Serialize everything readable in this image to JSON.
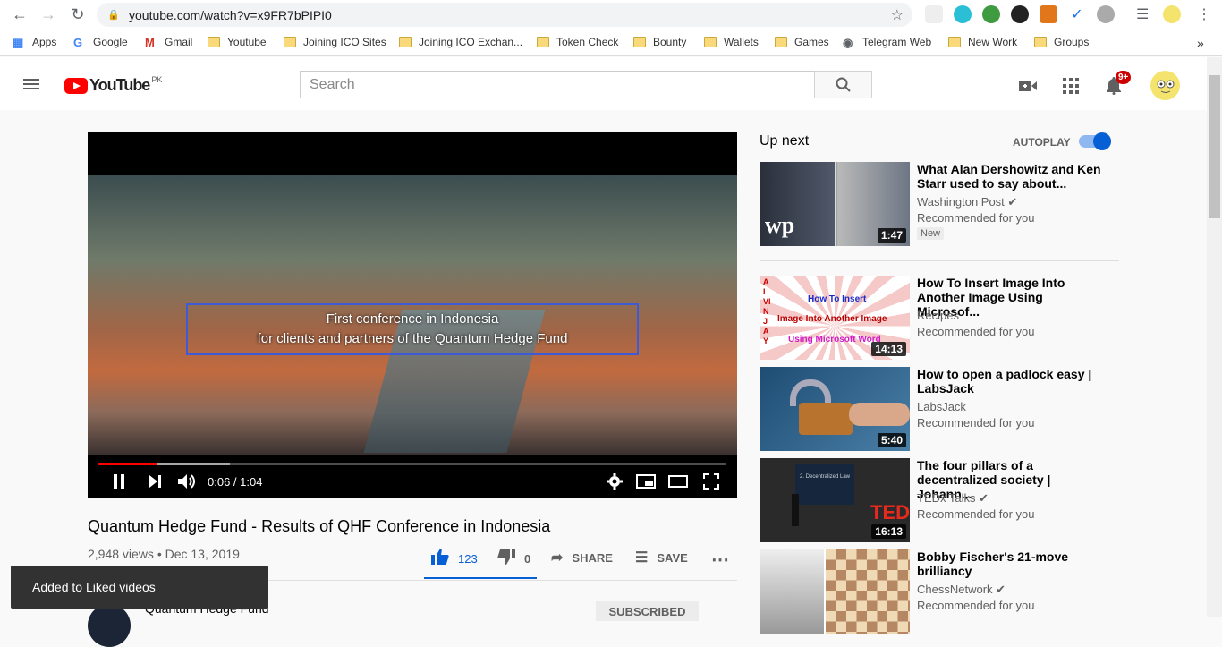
{
  "browser": {
    "url": "youtube.com/watch?v=x9FR7bPIPI0",
    "bookmarks": [
      "Apps",
      "Google",
      "Gmail",
      "Youtube",
      "Joining ICO Sites",
      "Joining ICO Exchan...",
      "Token Check",
      "Bounty",
      "Wallets",
      "Games",
      "Telegram Web",
      "New Work",
      "Groups"
    ],
    "more": "»"
  },
  "header": {
    "logo_word": "YouTube",
    "region": "PK",
    "search_placeholder": "Search",
    "notif_badge": "9+"
  },
  "player": {
    "caption_line1": "First conference in Indonesia",
    "caption_line2": "for clients and partners of the Quantum Hedge Fund",
    "time": "0:06 / 1:04",
    "progress_fraction": 0.094,
    "buffered_fraction": 0.21
  },
  "video": {
    "title": "Quantum Hedge Fund - Results of QHF Conference in Indonesia",
    "meta": "2,948 views • Dec 13, 2019",
    "likes": "123",
    "dislikes": "0",
    "share": "SHARE",
    "save": "SAVE",
    "channel": "Quantum Hedge Fund",
    "subscribe": "SUBSCRIBED"
  },
  "toast": "Added to Liked videos",
  "sidebar": {
    "up_next": "Up next",
    "autoplay": "AUTOPLAY",
    "items": [
      {
        "title1": "What Alan Dershowitz and Ken",
        "title2": "Starr used to say about...",
        "channel": "Washington Post",
        "rec": "Recommended for you",
        "duration": "1:47",
        "badge": "New"
      },
      {
        "title1": "How To Insert Image Into",
        "title2": "Another Image Using Microsof...",
        "channel": "Recipes",
        "rec": "Recommended for you",
        "duration": "14:13"
      },
      {
        "title1": "How to open a padlock easy |",
        "title2": "LabsJack",
        "channel": "LabsJack",
        "rec": "Recommended for you",
        "duration": "5:40"
      },
      {
        "title1": "The four pillars of a",
        "title2": "decentralized society | Johann...",
        "channel": "TEDx Talks",
        "rec": "Recommended for you",
        "duration": "16:13"
      },
      {
        "title1": "Bobby Fischer's 21-move",
        "title2": "brilliancy",
        "channel": "ChessNetwork",
        "rec": "Recommended for you",
        "duration": ""
      }
    ],
    "thumb_texts": {
      "insert_top": "How To Insert",
      "insert_mid": "Image Into Another Image",
      "insert_bot": "Using Microsoft Word",
      "side_letters": "ALVINJAY",
      "wp": "wp",
      "ted_slide": "2. Decentralized Law",
      "ted": "TEDx"
    }
  }
}
